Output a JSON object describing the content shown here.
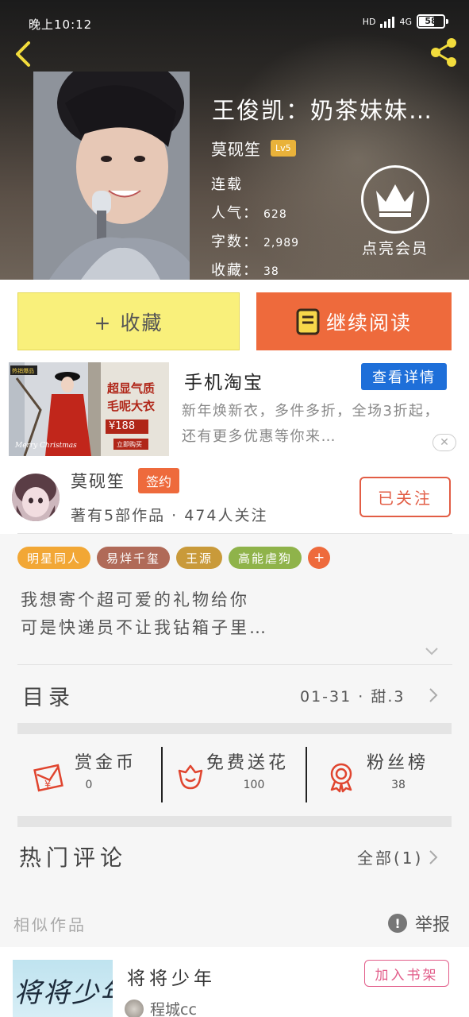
{
  "status_bar": {
    "time": "晚上10:12",
    "network": "HD",
    "signal": "4G",
    "battery": "58"
  },
  "book": {
    "title": "王俊凯：奶茶妹妹…",
    "author": "莫砚笙",
    "author_level": "Lv5",
    "status": "连载",
    "popularity_label": "人气：",
    "popularity": "628",
    "word_count_label": "字数：",
    "word_count": "2,989",
    "favorites_label": "收藏：",
    "favorites": "38"
  },
  "vip": {
    "label": "点亮会员"
  },
  "actions": {
    "collect_label": "+ 收藏",
    "read_label": "继续阅读"
  },
  "ad": {
    "title": "手机淘宝",
    "detail_button": "查看详情",
    "description": "新年焕新衣，多件多折，全场3折起，还有更多优惠等你来…",
    "close": "✕",
    "image_texts": {
      "headline_1": "超显气质",
      "headline_2": "毛呢大衣",
      "price": "¥188",
      "cta": "立即购买",
      "script": "Merry Christmas",
      "logo": "热销爆品"
    }
  },
  "author_card": {
    "name": "莫砚笙",
    "sign_badge": "签约",
    "stats": "著有5部作品 · 474人关注",
    "follow_button": "已关注"
  },
  "tags": [
    {
      "label": "明星同人",
      "color": "#f2a735"
    },
    {
      "label": "易烊千玺",
      "color": "#b06a58"
    },
    {
      "label": "王源",
      "color": "#c99a3a"
    },
    {
      "label": "高能虐狗",
      "color": "#8fb34a"
    }
  ],
  "tag_add": "+",
  "intro": {
    "line1": "我想寄个超可爱的礼物给你",
    "line2": "可是快递员不让我钻箱子里…"
  },
  "catalog": {
    "label": "目录",
    "latest": "01-31  ·  甜.3"
  },
  "rewards": [
    {
      "name": "赏金币",
      "count": "0"
    },
    {
      "name": "免费送花",
      "count": "100"
    },
    {
      "name": "粉丝榜",
      "count": "38"
    }
  ],
  "comments": {
    "title": "热门评论",
    "all": "全部(1)"
  },
  "similar": {
    "label": "相似作品",
    "report": "举报",
    "item": {
      "title": "将将少年",
      "cover_text": "将将少年",
      "author": "程城cc",
      "shelf_button": "加入书架"
    }
  },
  "colors": {
    "accent_orange": "#ee6a3c",
    "collect_yellow": "#f9f07b",
    "detail_blue": "#1e6fd9",
    "reward_red": "#e0452f"
  }
}
